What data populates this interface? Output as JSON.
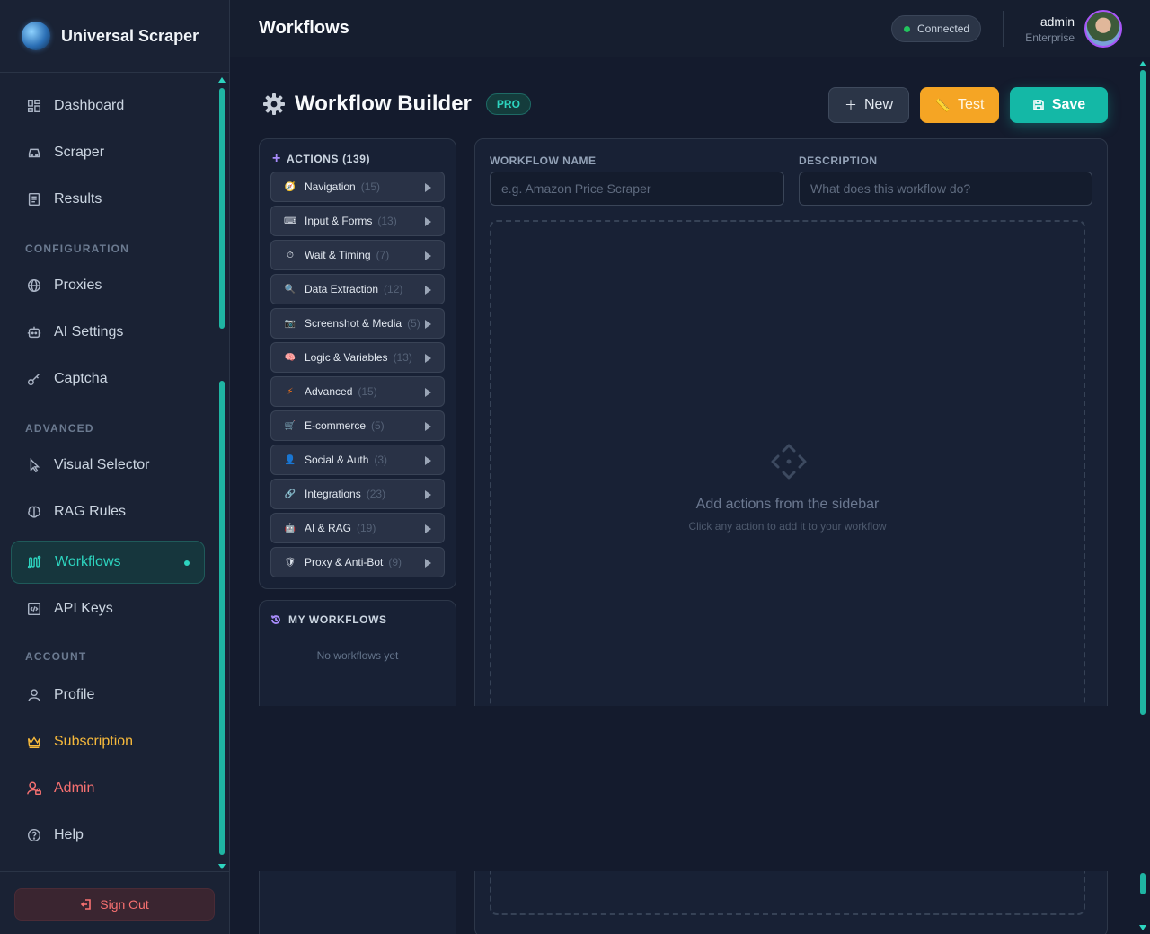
{
  "app": {
    "name": "Universal Scraper"
  },
  "header": {
    "title": "Workflows",
    "status": "Connected",
    "user_name": "admin",
    "user_plan": "Enterprise"
  },
  "sidebar": {
    "items": [
      {
        "label": "Dashboard",
        "icon": "dashboard-icon"
      },
      {
        "label": "Scraper",
        "icon": "car-icon"
      },
      {
        "label": "Results",
        "icon": "document-icon"
      },
      {
        "label": "Proxies",
        "icon": "globe-icon"
      },
      {
        "label": "AI Settings",
        "icon": "robot-icon"
      },
      {
        "label": "Captcha",
        "icon": "key-icon"
      },
      {
        "label": "Visual Selector",
        "icon": "cursor-icon"
      },
      {
        "label": "RAG Rules",
        "icon": "brain-icon"
      },
      {
        "label": "Workflows",
        "icon": "workflow-icon",
        "active": true
      },
      {
        "label": "API Keys",
        "icon": "code-icon"
      },
      {
        "label": "Profile",
        "icon": "user-icon"
      },
      {
        "label": "Subscription",
        "icon": "crown-icon"
      },
      {
        "label": "Admin",
        "icon": "user-lock-icon"
      },
      {
        "label": "Help",
        "icon": "help-icon"
      }
    ],
    "sections": {
      "configuration": "CONFIGURATION",
      "advanced": "ADVANCED",
      "account": "ACCOUNT"
    },
    "sign_out": "Sign Out"
  },
  "builder": {
    "title": "Workflow Builder",
    "badge": "PRO",
    "buttons": {
      "new": "New",
      "test": "Test",
      "save": "Save"
    },
    "actions_header": "ACTIONS (139)",
    "categories": [
      {
        "label": "Navigation",
        "count": "(15)",
        "icon": "compass-icon"
      },
      {
        "label": "Input & Forms",
        "count": "(13)",
        "icon": "keyboard-icon"
      },
      {
        "label": "Wait & Timing",
        "count": "(7)",
        "icon": "stopwatch-icon"
      },
      {
        "label": "Data Extraction",
        "count": "(12)",
        "icon": "magnifier-icon"
      },
      {
        "label": "Screenshot & Media",
        "count": "(5)",
        "icon": "camera-icon"
      },
      {
        "label": "Logic & Variables",
        "count": "(13)",
        "icon": "brain-icon"
      },
      {
        "label": "Advanced",
        "count": "(15)",
        "icon": "lightning-icon"
      },
      {
        "label": "E-commerce",
        "count": "(5)",
        "icon": "cart-icon"
      },
      {
        "label": "Social & Auth",
        "count": "(3)",
        "icon": "person-icon"
      },
      {
        "label": "Integrations",
        "count": "(23)",
        "icon": "link-icon"
      },
      {
        "label": "AI & RAG",
        "count": "(19)",
        "icon": "robot-icon"
      },
      {
        "label": "Proxy & Anti-Bot",
        "count": "(9)",
        "icon": "shield-icon"
      }
    ],
    "my_workflows_header": "MY WORKFLOWS",
    "my_workflows_empty": "No workflows yet",
    "workflow_name_label": "WORKFLOW NAME",
    "workflow_name_placeholder": "e.g. Amazon Price Scraper",
    "description_label": "DESCRIPTION",
    "description_placeholder": "What does this workflow do?",
    "empty_title": "Add actions from the sidebar",
    "empty_sub": "Click any action to add it to your workflow"
  },
  "colors": {
    "accent": "#2dd4bf",
    "gold": "#f6b93b",
    "danger": "#f87171",
    "test": "#f5a524",
    "save": "#14b8a6"
  }
}
